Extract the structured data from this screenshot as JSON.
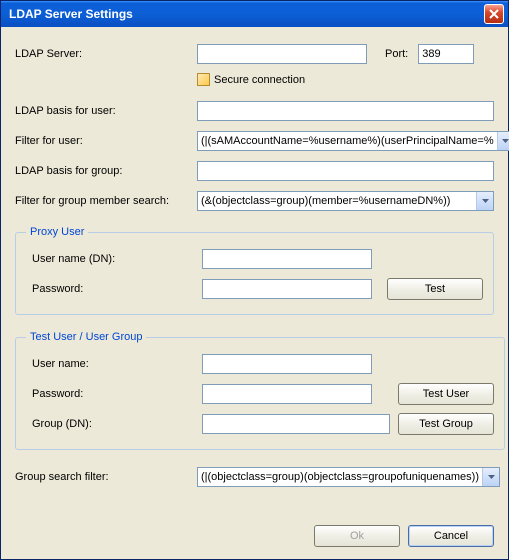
{
  "window": {
    "title": "LDAP Server Settings"
  },
  "server": {
    "label": "LDAP Server:",
    "value": "",
    "port_label": "Port:",
    "port_value": "389",
    "secure_label": "Secure connection",
    "secure_checked": false
  },
  "fields": {
    "basis_user_label": "LDAP basis for user:",
    "basis_user_value": "",
    "filter_user_label": "Filter for user:",
    "filter_user_value": "(|(sAMAccountName=%username%)(userPrincipalName=%",
    "basis_group_label": "LDAP basis for group:",
    "basis_group_value": "",
    "filter_group_member_label": "Filter for group member search:",
    "filter_group_member_value": "(&(objectclass=group)(member=%usernameDN%))"
  },
  "proxy": {
    "legend": "Proxy User",
    "username_label": "User name (DN):",
    "username_value": "",
    "password_label": "Password:",
    "password_value": "",
    "test_label": "Test"
  },
  "testuser": {
    "legend": "Test User / User Group",
    "username_label": "User name:",
    "username_value": "",
    "password_label": "Password:",
    "password_value": "",
    "group_label": "Group (DN):",
    "group_value": "",
    "test_user_label": "Test User",
    "test_group_label": "Test Group"
  },
  "group_search": {
    "label": "Group search filter:",
    "value": "(|(objectclass=group)(objectclass=groupofuniquenames))"
  },
  "buttons": {
    "ok": "Ok",
    "cancel": "Cancel"
  }
}
